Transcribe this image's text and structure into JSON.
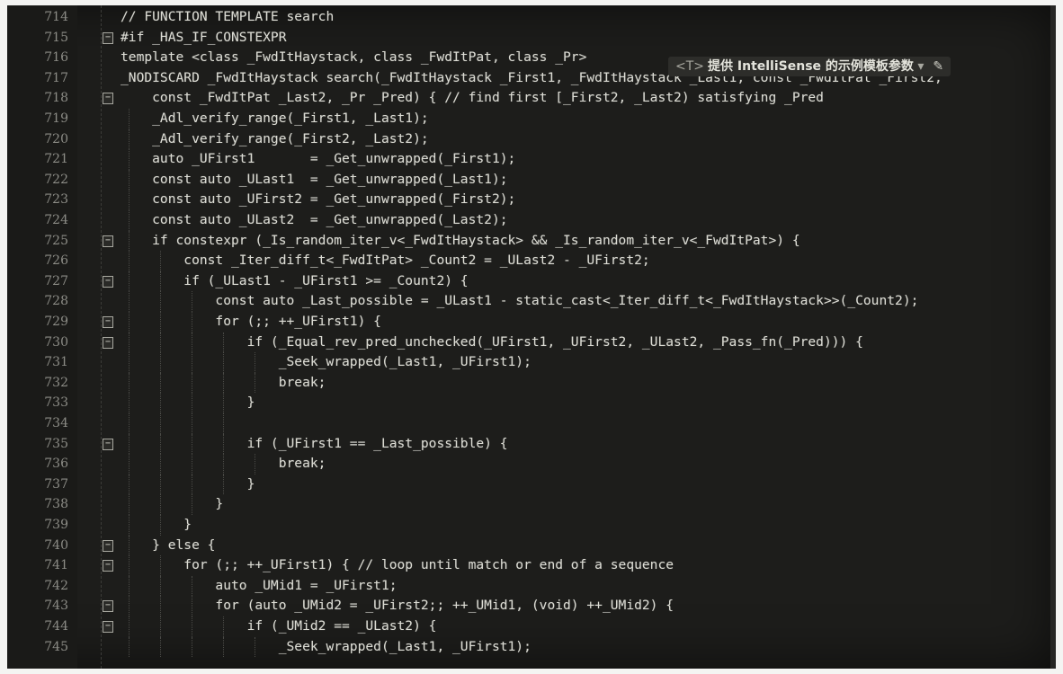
{
  "editor": {
    "hint": {
      "type_param": "<T>",
      "text": "提供 IntelliSense 的示例模板参数",
      "dropdown_icon": "chevron-down-icon",
      "edit_icon": "pencil-icon"
    },
    "lines": [
      {
        "num": "714",
        "code": "// FUNCTION TEMPLATE search",
        "fold": "",
        "indent": 0
      },
      {
        "num": "715",
        "code": "#if _HAS_IF_CONSTEXPR",
        "fold": "⊟",
        "indent": 0
      },
      {
        "num": "716",
        "code": "template <class _FwdItHaystack, class _FwdItPat, class _Pr>",
        "fold": "",
        "indent": 0
      },
      {
        "num": "717",
        "code": "_NODISCARD _FwdItHaystack search(_FwdItHaystack _First1, _FwdItHaystack _Last1, const _FwdItPat _First2,",
        "fold": "",
        "indent": 0
      },
      {
        "num": "718",
        "code": "    const _FwdItPat _Last2, _Pr _Pred) { // find first [_First2, _Last2) satisfying _Pred",
        "fold": "⊟",
        "indent": 0
      },
      {
        "num": "719",
        "code": "    _Adl_verify_range(_First1, _Last1);",
        "fold": "",
        "indent": 1
      },
      {
        "num": "720",
        "code": "    _Adl_verify_range(_First2, _Last2);",
        "fold": "",
        "indent": 1
      },
      {
        "num": "721",
        "code": "    auto _UFirst1       = _Get_unwrapped(_First1);",
        "fold": "",
        "indent": 1
      },
      {
        "num": "722",
        "code": "    const auto _ULast1  = _Get_unwrapped(_Last1);",
        "fold": "",
        "indent": 1
      },
      {
        "num": "723",
        "code": "    const auto _UFirst2 = _Get_unwrapped(_First2);",
        "fold": "",
        "indent": 1
      },
      {
        "num": "724",
        "code": "    const auto _ULast2  = _Get_unwrapped(_Last2);",
        "fold": "",
        "indent": 1
      },
      {
        "num": "725",
        "code": "    if constexpr (_Is_random_iter_v<_FwdItHaystack> && _Is_random_iter_v<_FwdItPat>) {",
        "fold": "⊟",
        "indent": 1
      },
      {
        "num": "726",
        "code": "        const _Iter_diff_t<_FwdItPat> _Count2 = _ULast2 - _UFirst2;",
        "fold": "",
        "indent": 2
      },
      {
        "num": "727",
        "code": "        if (_ULast1 - _UFirst1 >= _Count2) {",
        "fold": "⊟",
        "indent": 2
      },
      {
        "num": "728",
        "code": "            const auto _Last_possible = _ULast1 - static_cast<_Iter_diff_t<_FwdItHaystack>>(_Count2);",
        "fold": "",
        "indent": 3
      },
      {
        "num": "729",
        "code": "            for (;; ++_UFirst1) {",
        "fold": "⊟",
        "indent": 3
      },
      {
        "num": "730",
        "code": "                if (_Equal_rev_pred_unchecked(_UFirst1, _UFirst2, _ULast2, _Pass_fn(_Pred))) {",
        "fold": "⊟",
        "indent": 4
      },
      {
        "num": "731",
        "code": "                    _Seek_wrapped(_Last1, _UFirst1);",
        "fold": "",
        "indent": 5
      },
      {
        "num": "732",
        "code": "                    break;",
        "fold": "",
        "indent": 5
      },
      {
        "num": "733",
        "code": "                }",
        "fold": "",
        "indent": 4
      },
      {
        "num": "734",
        "code": "",
        "fold": "",
        "indent": 4
      },
      {
        "num": "735",
        "code": "                if (_UFirst1 == _Last_possible) {",
        "fold": "⊟",
        "indent": 4
      },
      {
        "num": "736",
        "code": "                    break;",
        "fold": "",
        "indent": 5
      },
      {
        "num": "737",
        "code": "                }",
        "fold": "",
        "indent": 4
      },
      {
        "num": "738",
        "code": "            }",
        "fold": "",
        "indent": 3
      },
      {
        "num": "739",
        "code": "        }",
        "fold": "",
        "indent": 2
      },
      {
        "num": "740",
        "code": "    } else {",
        "fold": "⊟",
        "indent": 1
      },
      {
        "num": "741",
        "code": "        for (;; ++_UFirst1) { // loop until match or end of a sequence",
        "fold": "⊟",
        "indent": 2
      },
      {
        "num": "742",
        "code": "            auto _UMid1 = _UFirst1;",
        "fold": "",
        "indent": 3
      },
      {
        "num": "743",
        "code": "            for (auto _UMid2 = _UFirst2;; ++_UMid1, (void) ++_UMid2) {",
        "fold": "⊟",
        "indent": 3
      },
      {
        "num": "744",
        "code": "                if (_UMid2 == _ULast2) {",
        "fold": "⊟",
        "indent": 4
      },
      {
        "num": "745",
        "code": "                    _Seek_wrapped(_Last1, _UFirst1);",
        "fold": "",
        "indent": 5
      }
    ]
  }
}
